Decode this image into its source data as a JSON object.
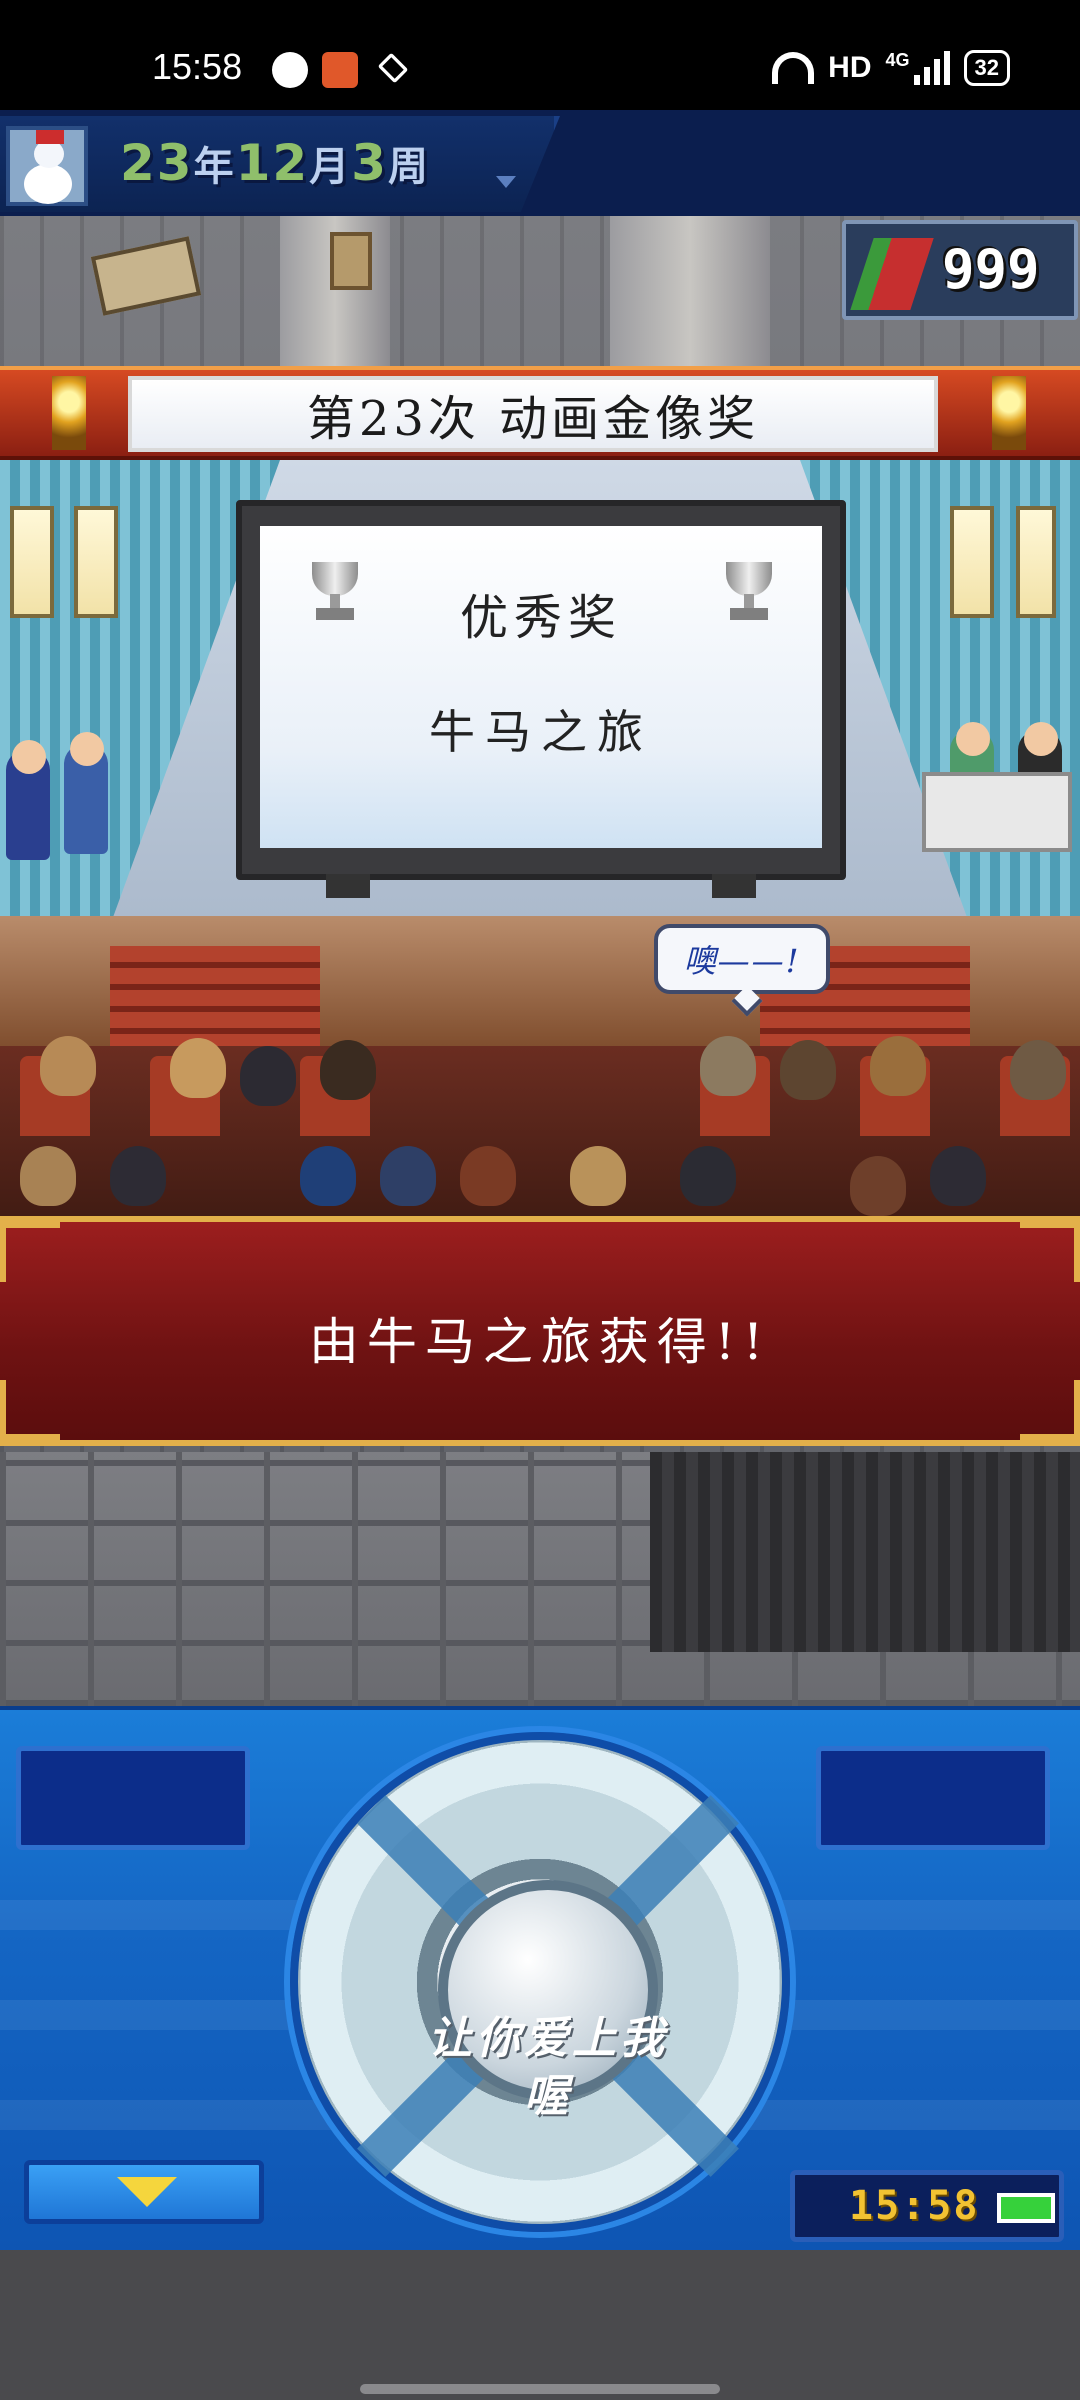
{
  "status_bar": {
    "time": "15:58",
    "network": "HD",
    "network_gen": "4G",
    "battery": "32",
    "icons": [
      "globe-icon",
      "app-icon",
      "layers-icon",
      "wifi-icon",
      "signal-icon",
      "battery-icon"
    ]
  },
  "top_bar": {
    "date_year": "23",
    "date_year_unit": "年",
    "date_month": "12",
    "date_month_unit": "月",
    "date_week": "3",
    "date_week_unit": "周",
    "counter_value": "999"
  },
  "award": {
    "banner_title": "第23次 动画金像奖",
    "award_name": "优秀奖",
    "work_title": "牛马之旅"
  },
  "speech_bubble": "噢——!",
  "message": "由牛马之旅获得!!",
  "controller": {
    "center_label": "让你爱上我\n喔",
    "clock": "15:58"
  },
  "colors": {
    "controller_blue": "#1466c4",
    "message_red": "#8a1919",
    "gold": "#e3b04a"
  }
}
